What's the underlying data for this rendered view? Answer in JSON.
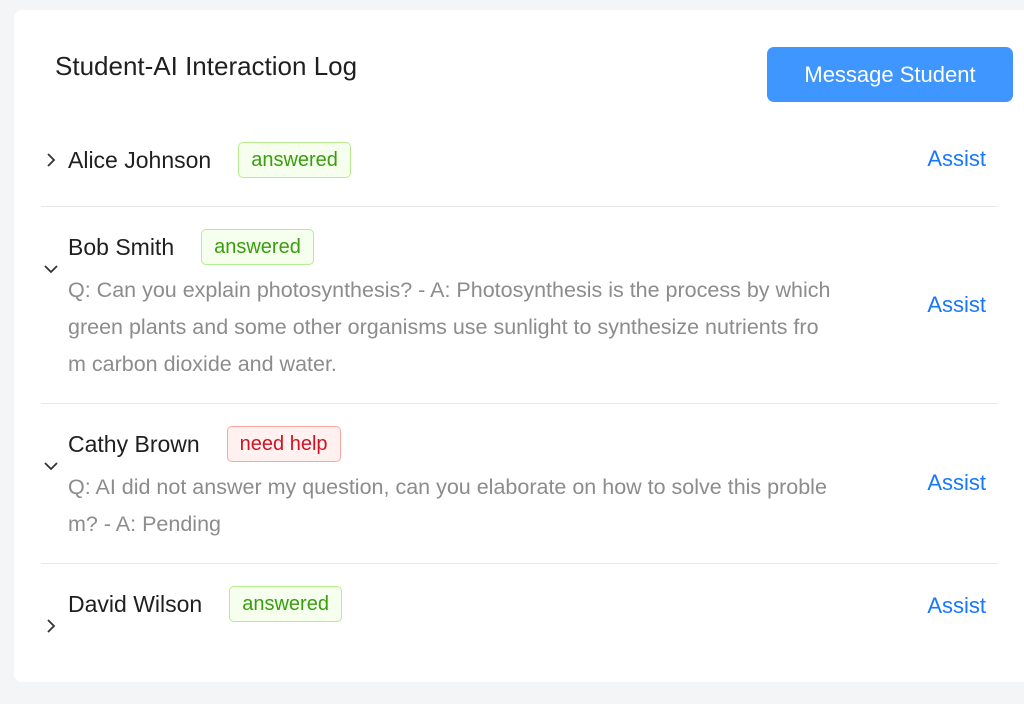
{
  "header": {
    "title": "Student-AI Interaction Log",
    "message_button": "Message Student"
  },
  "items": [
    {
      "name": "Alice Johnson",
      "status": "answered",
      "status_type": "answered",
      "expanded": false,
      "description": "",
      "action": "Assist"
    },
    {
      "name": "Bob Smith",
      "status": "answered",
      "status_type": "answered",
      "expanded": true,
      "description": "Q: Can you explain photosynthesis? - A: Photosynthesis is the process by which green plants and some other organisms use sunlight to synthesize nutrients from carbon dioxide and water.",
      "action": "Assist"
    },
    {
      "name": "Cathy Brown",
      "status": "need help",
      "status_type": "help",
      "expanded": true,
      "description": "Q: AI did not answer my question, can you elaborate on how to solve this problem? - A: Pending",
      "action": "Assist"
    },
    {
      "name": "David Wilson",
      "status": "answered",
      "status_type": "answered",
      "expanded": false,
      "description": "",
      "action": "Assist"
    }
  ],
  "colors": {
    "primary": "#4096ff",
    "link": "#1677ff",
    "answered": "#389e0d",
    "need_help": "#cf1322"
  },
  "icons": {
    "collapsed": "chevron-right-icon",
    "expanded": "chevron-down-icon"
  }
}
